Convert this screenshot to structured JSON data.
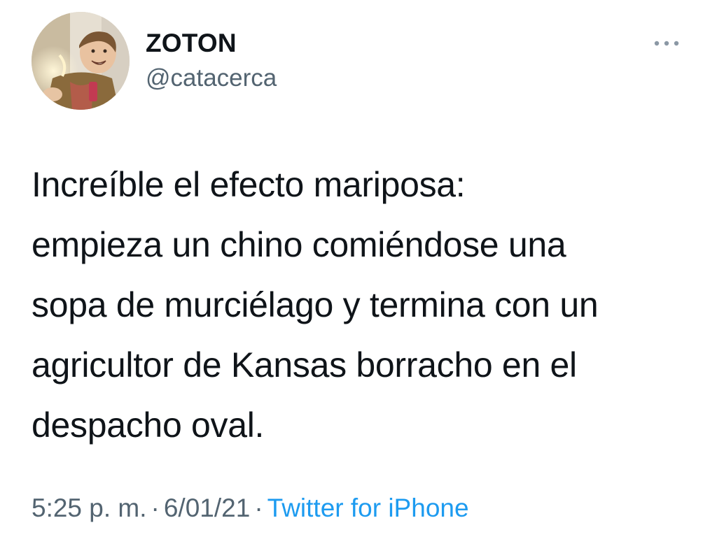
{
  "author": {
    "display_name": "ZOTON",
    "handle": "@catacerca",
    "avatar_icon": "avatar-photo"
  },
  "more_icon": "more-horizontal-icon",
  "tweet": {
    "text": "Increíble el efecto mariposa:\nempieza un chino comiéndose una\nsopa de murciélago y termina con un\nagricultor de Kansas borracho en el\ndespacho oval."
  },
  "meta": {
    "time": "5:25 p. m.",
    "separator": "·",
    "date": "6/01/21",
    "source": "Twitter for iPhone"
  },
  "colors": {
    "text": "#0f1419",
    "secondary": "#536471",
    "link": "#1d9bf0",
    "background": "#ffffff"
  }
}
